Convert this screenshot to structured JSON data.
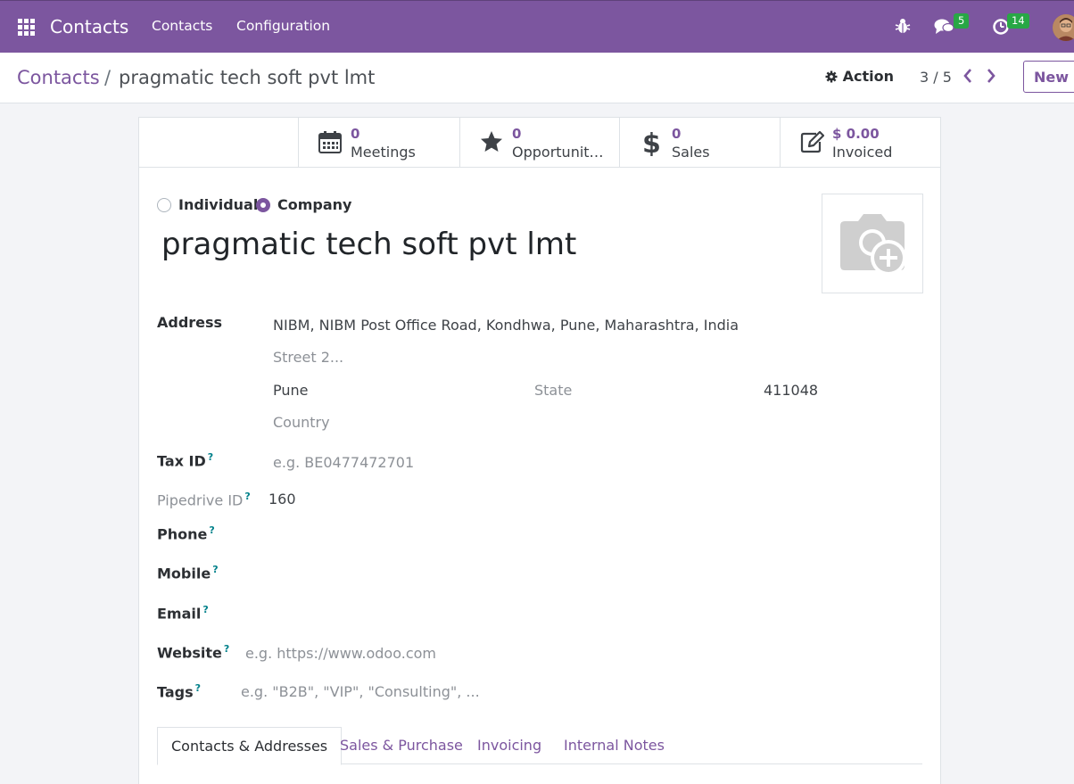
{
  "navbar": {
    "brand": "Contacts",
    "menu": [
      "Contacts",
      "Configuration"
    ],
    "messages_count": "5",
    "activities_count": "14",
    "accent_color": "#7c569f",
    "badge_color": "#28a745"
  },
  "control": {
    "breadcrumb_root": "Contacts",
    "breadcrumb_separator": "/",
    "breadcrumb_current": "pragmatic tech soft pvt lmt",
    "action_label": "Action",
    "pager": "3 / 5",
    "new_label": "New"
  },
  "stats": [
    {
      "value": "0",
      "label": "Meetings",
      "icon": "calendar-icon"
    },
    {
      "value": "0",
      "label": "Opportunit…",
      "icon": "star-icon"
    },
    {
      "value": "0",
      "label": "Sales",
      "icon": "dollar-icon"
    },
    {
      "value": "$ 0.00",
      "label": "Invoiced",
      "icon": "edit-icon"
    }
  ],
  "company_type": {
    "individual": "Individual",
    "company": "Company",
    "selected": "Company"
  },
  "partner_name": "pragmatic tech soft pvt lmt",
  "fields": {
    "address_label": "Address",
    "street": "NIBM, NIBM Post Office Road, Kondhwa, Pune, Maharashtra, India",
    "street2_placeholder": "Street 2...",
    "city": "Pune",
    "state_placeholder": "State",
    "zip": "411048",
    "country_placeholder": "Country",
    "tax_id_label": "Tax ID",
    "tax_id_placeholder": "e.g. BE0477472701",
    "pipedrive_label": "Pipedrive ID",
    "pipedrive_value": "160",
    "phone_label": "Phone",
    "mobile_label": "Mobile",
    "email_label": "Email",
    "website_label": "Website",
    "website_placeholder": "e.g. https://www.odoo.com",
    "tags_label": "Tags",
    "tags_placeholder": "e.g. \"B2B\", \"VIP\", \"Consulting\", ...",
    "help_mark": "?"
  },
  "tabs": [
    "Contacts & Addresses",
    "Sales & Purchase",
    "Invoicing",
    "Internal Notes"
  ]
}
